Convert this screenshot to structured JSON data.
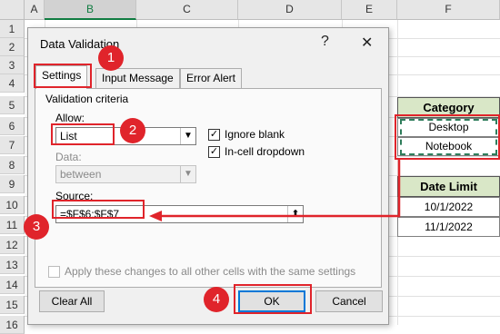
{
  "sheet": {
    "columns": [
      "A",
      "B",
      "C",
      "D",
      "E",
      "F"
    ],
    "selected_column": "B",
    "rows": [
      "1",
      "2",
      "3",
      "4",
      "5",
      "6",
      "7",
      "8",
      "9",
      "10",
      "11",
      "12",
      "13",
      "14",
      "15",
      "16"
    ],
    "category": {
      "header": "Category",
      "items": [
        "Desktop",
        "Notebook"
      ]
    },
    "date_limit": {
      "header": "Date Limit",
      "items": [
        "10/1/2022",
        "11/1/2022"
      ]
    }
  },
  "dialog": {
    "title": "Data Validation",
    "help_icon": "?",
    "close_icon": "✕",
    "tabs": [
      "Settings",
      "Input Message",
      "Error Alert"
    ],
    "active_tab": "Settings",
    "criteria_label": "Validation criteria",
    "allow_label": "Allow:",
    "allow_value": "List",
    "data_label": "Data:",
    "data_value": "between",
    "ignore_blank_label": "Ignore blank",
    "ignore_blank_checked": true,
    "incell_label": "In-cell dropdown",
    "incell_checked": true,
    "source_label": "Source:",
    "source_value": "=$F$6:$F$7",
    "apply_label": "Apply these changes to all other cells with the same settings",
    "apply_checked": false,
    "clear_all": "Clear All",
    "ok": "OK",
    "cancel": "Cancel"
  },
  "annotations": {
    "badges": [
      "1",
      "2",
      "3",
      "4"
    ],
    "color": "#e0242b"
  }
}
